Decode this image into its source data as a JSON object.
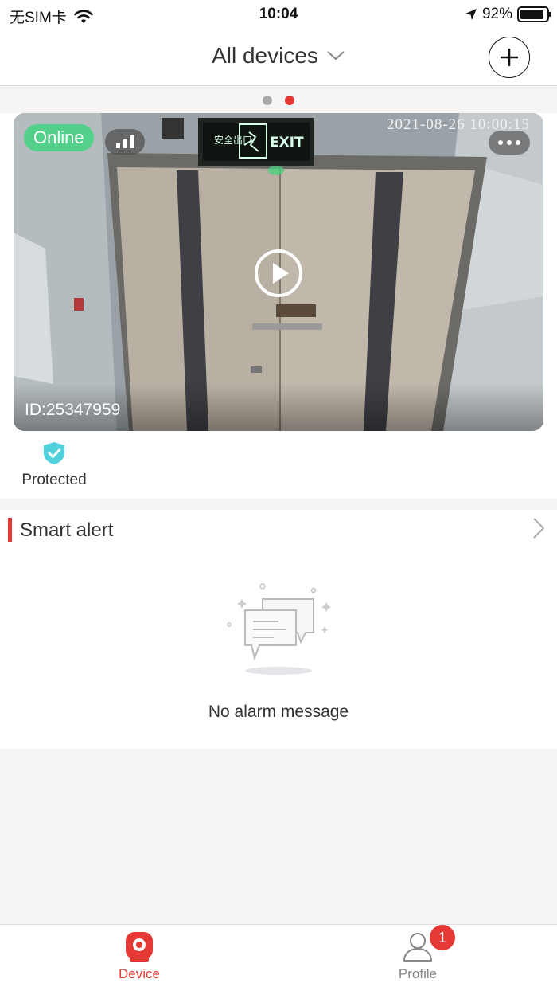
{
  "status_bar": {
    "carrier": "无SIM卡",
    "time": "10:04",
    "battery": "92%",
    "battery_level": 0.92
  },
  "nav": {
    "title": "All devices"
  },
  "pager": {
    "pages": 2,
    "active_index": 1
  },
  "camera": {
    "status": "Online",
    "timestamp": "2021-08-26 10:00:15",
    "device_id": "ID:25347959",
    "signal_bars": 3
  },
  "protection": {
    "label": "Protected"
  },
  "alerts": {
    "title": "Smart alert",
    "empty_message": "No alarm message"
  },
  "tabs": [
    {
      "label": "Device",
      "active": true
    },
    {
      "label": "Profile",
      "active": false,
      "badge": "1"
    }
  ],
  "colors": {
    "accent": "#e53935",
    "online": "#53d08a",
    "shield": "#4fd2dc",
    "background": "#f5f5f5"
  }
}
